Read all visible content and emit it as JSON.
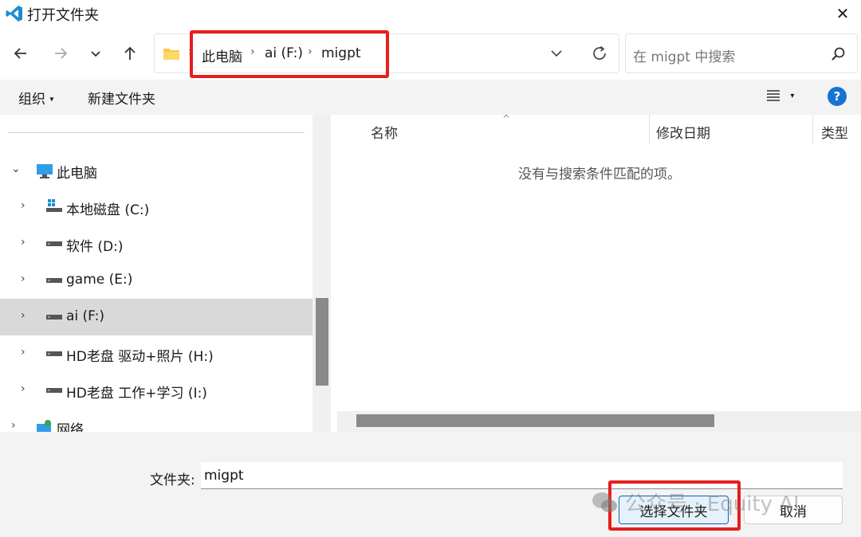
{
  "window": {
    "title": "打开文件夹",
    "close_icon": "close-icon"
  },
  "nav": {
    "breadcrumb": [
      "此电脑",
      "ai (F:)",
      "migpt"
    ],
    "search_placeholder": "在 migpt 中搜索"
  },
  "toolbar": {
    "organize": "组织",
    "new_folder": "新建文件夹"
  },
  "tree": {
    "items": [
      {
        "label": "此电脑",
        "icon": "computer-icon",
        "expanded": true
      },
      {
        "label": "本地磁盘 (C:)",
        "icon": "windows-drive-icon"
      },
      {
        "label": "软件 (D:)",
        "icon": "drive-icon"
      },
      {
        "label": "game (E:)",
        "icon": "drive-icon"
      },
      {
        "label": "ai (F:)",
        "icon": "drive-icon",
        "selected": true
      },
      {
        "label": "HD老盘 驱动+照片 (H:)",
        "icon": "drive-icon"
      },
      {
        "label": "HD老盘 工作+学习 (I:)",
        "icon": "drive-icon"
      },
      {
        "label": "网络",
        "icon": "network-icon"
      }
    ]
  },
  "list": {
    "columns": [
      "名称",
      "修改日期",
      "类型"
    ],
    "empty_message": "没有与搜索条件匹配的项。"
  },
  "footer": {
    "folder_label": "文件夹:",
    "folder_value": "migpt",
    "select_button": "选择文件夹",
    "cancel_button": "取消"
  },
  "watermark": {
    "text": "公众号 · Equity AI"
  },
  "colors": {
    "accent": "#0067c0",
    "highlight": "#e61e1e",
    "selected_row": "#d9d9d9"
  }
}
